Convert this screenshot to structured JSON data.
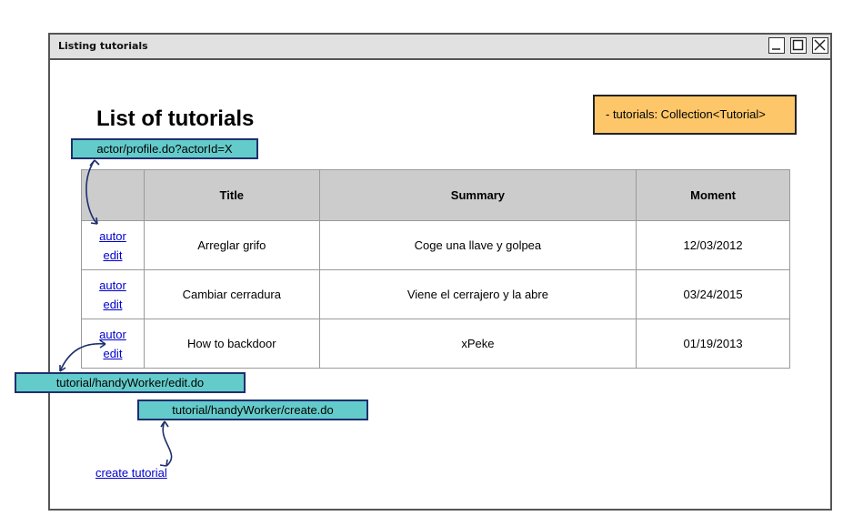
{
  "window": {
    "title": "Listing tutorials"
  },
  "page": {
    "heading": "List of tutorials"
  },
  "note": {
    "text": "- tutorials: Collection<Tutorial>"
  },
  "callouts": {
    "profile": "actor/profile.do?actorId=X",
    "edit": "tutorial/handyWorker/edit.do",
    "create": "tutorial/handyWorker/create.do"
  },
  "table": {
    "headers": [
      "",
      "Title",
      "Summary",
      "Moment"
    ],
    "rows": [
      {
        "autor": "autor",
        "edit": "edit",
        "title": "Arreglar grifo",
        "summary": "Coge una llave y golpea",
        "moment": "12/03/2012"
      },
      {
        "autor": "autor",
        "edit": "edit",
        "title": "Cambiar cerradura",
        "summary": "Viene el cerrajero y la abre",
        "moment": "03/24/2015"
      },
      {
        "autor": "autor",
        "edit": "edit",
        "title": "How to backdoor",
        "summary": "xPeke",
        "moment": "01/19/2013"
      }
    ]
  },
  "actions": {
    "create_label": "create tutorial"
  },
  "colors": {
    "callout_bg": "#64cbcb",
    "note_bg": "#fdc769",
    "link": "#0000cc",
    "header_bg": "#cccccc"
  }
}
